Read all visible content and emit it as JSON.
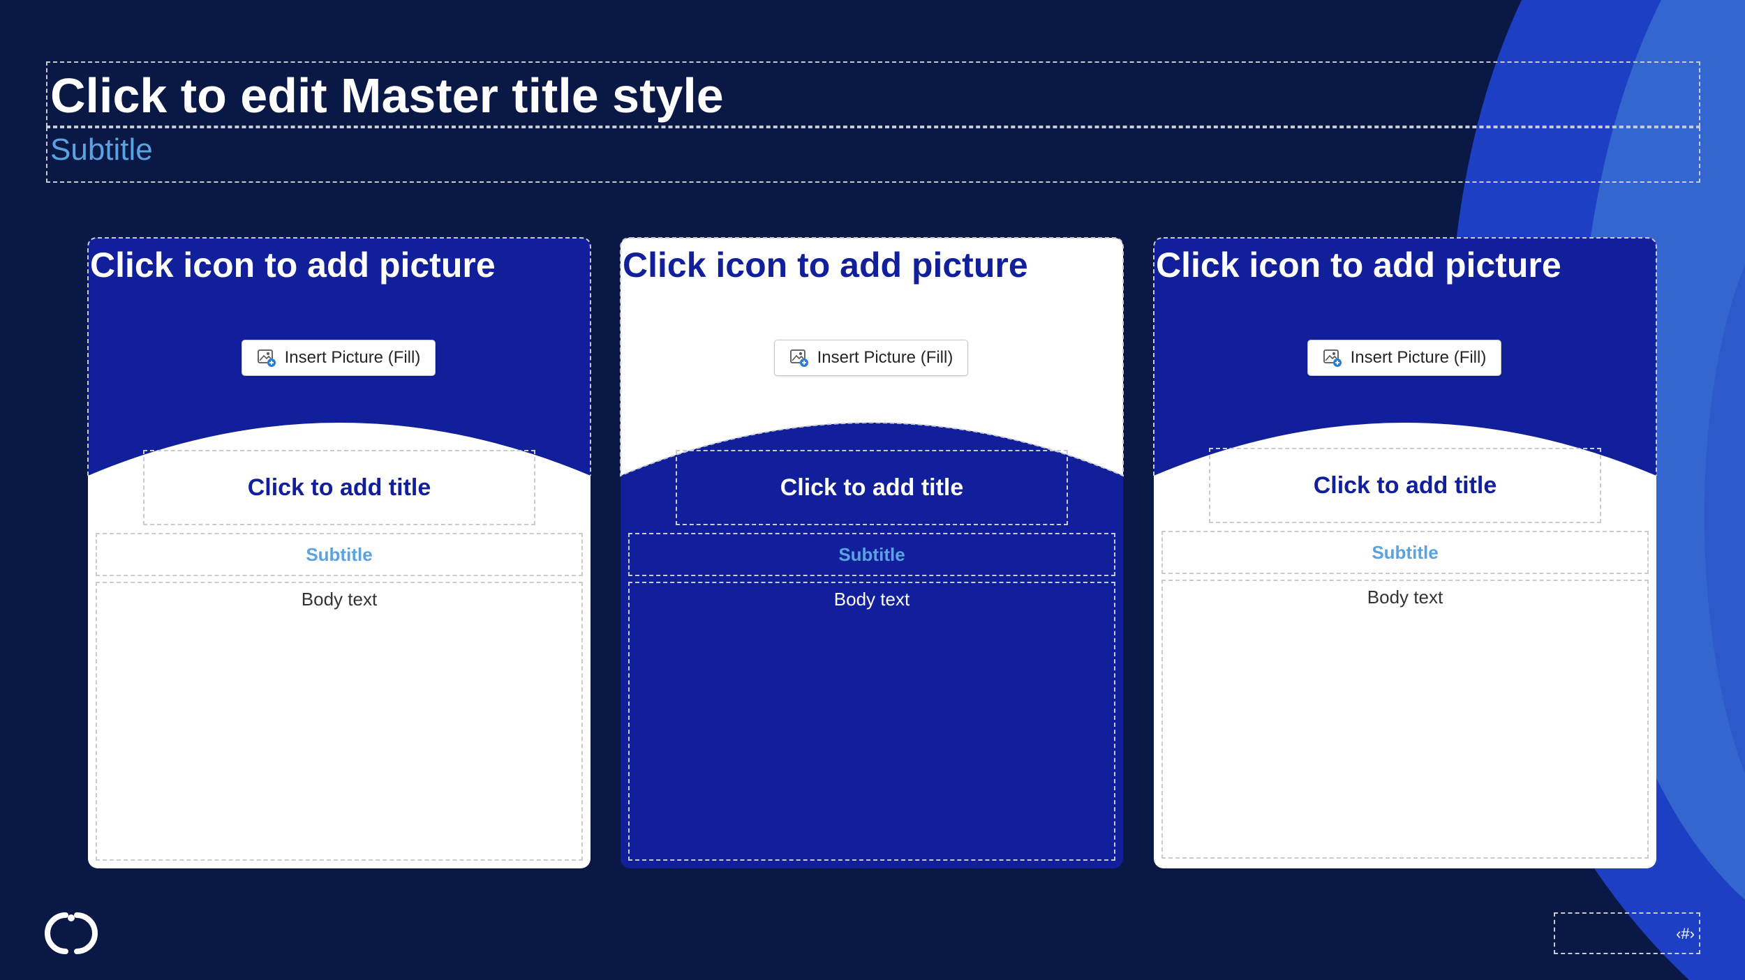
{
  "colors": {
    "background": "#0a1846",
    "navy": "#121f9a",
    "white": "#ffffff",
    "accent_blue": "#5aa3e0",
    "arc_mid": "#1d3fc4",
    "arc_light": "#3367cf"
  },
  "master": {
    "title": "Click to edit Master title style",
    "subtitle": "Subtitle"
  },
  "cards": [
    {
      "picture_caption": "Click icon to add picture",
      "insert_button": "Insert Picture (Fill)",
      "insert_icon": "insert-picture-icon",
      "title": "Click to add title",
      "subtitle": "Subtitle",
      "body": "Body text",
      "top_color": "#121f9a",
      "bottom_color": "#ffffff"
    },
    {
      "picture_caption": "Click icon to add picture",
      "insert_button": "Insert Picture (Fill)",
      "insert_icon": "insert-picture-icon",
      "title": "Click to add title",
      "subtitle": "Subtitle",
      "body": "Body text",
      "top_color": "#ffffff",
      "bottom_color": "#121f9a"
    },
    {
      "picture_caption": "Click icon to add picture",
      "insert_button": "Insert Picture (Fill)",
      "insert_icon": "insert-picture-icon",
      "title": "Click to add title",
      "subtitle": "Subtitle",
      "body": "Body text",
      "top_color": "#121f9a",
      "bottom_color": "#ffffff"
    }
  ],
  "footer": {
    "logo_icon": "brand-logo-icon",
    "page_number": "‹#›"
  }
}
